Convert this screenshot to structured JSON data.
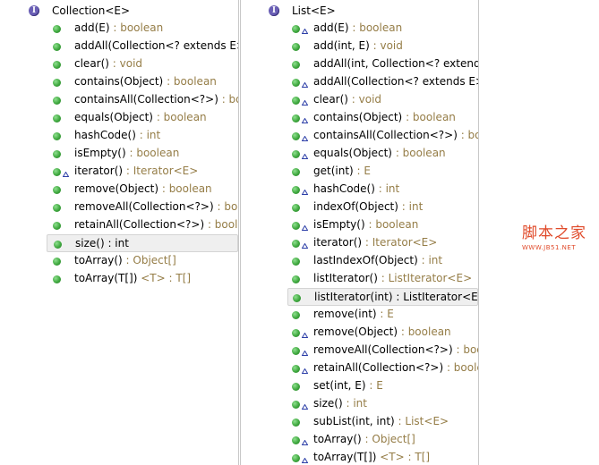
{
  "left": {
    "header": {
      "icon": "interface-icon",
      "icon_glyph": "I",
      "title": "Collection<E>"
    },
    "items": [
      {
        "sig": "add(E)",
        "ret": " : boolean",
        "abstract": false
      },
      {
        "sig": "addAll(Collection<? extends E>",
        "ret": "",
        "abstract": false
      },
      {
        "sig": "clear()",
        "ret": " : void",
        "abstract": false
      },
      {
        "sig": "contains(Object)",
        "ret": " : boolean",
        "abstract": false
      },
      {
        "sig": "containsAll(Collection<?>)",
        "ret": " : boo",
        "abstract": false
      },
      {
        "sig": "equals(Object)",
        "ret": " : boolean",
        "abstract": false
      },
      {
        "sig": "hashCode()",
        "ret": " : int",
        "abstract": false
      },
      {
        "sig": "isEmpty()",
        "ret": " : boolean",
        "abstract": false
      },
      {
        "sig": "iterator()",
        "ret": " : Iterator<E>",
        "abstract": true
      },
      {
        "sig": "remove(Object)",
        "ret": " : boolean",
        "abstract": false
      },
      {
        "sig": "removeAll(Collection<?>)",
        "ret": " : boo",
        "abstract": false
      },
      {
        "sig": "retainAll(Collection<?>)",
        "ret": " : boole",
        "abstract": false
      },
      {
        "sig": "size() : int",
        "ret": "",
        "abstract": false,
        "selected": true
      },
      {
        "sig": "toArray()",
        "ret": " : Object[]",
        "abstract": false
      },
      {
        "sig": "toArray(T[])",
        "ret": " <T> : T[]",
        "abstract": false
      }
    ]
  },
  "right": {
    "header": {
      "icon": "interface-icon",
      "icon_glyph": "I",
      "title": "List<E>"
    },
    "items": [
      {
        "sig": "add(E)",
        "ret": " : boolean",
        "abstract": true
      },
      {
        "sig": "add(int, E)",
        "ret": " : void",
        "abstract": false
      },
      {
        "sig": "addAll(int, Collection<? extends",
        "ret": "",
        "abstract": false
      },
      {
        "sig": "addAll(Collection<? extends E>",
        "ret": "",
        "abstract": true
      },
      {
        "sig": "clear()",
        "ret": " : void",
        "abstract": true
      },
      {
        "sig": "contains(Object)",
        "ret": " : boolean",
        "abstract": true
      },
      {
        "sig": "containsAll(Collection<?>)",
        "ret": " : boo",
        "abstract": true
      },
      {
        "sig": "equals(Object)",
        "ret": " : boolean",
        "abstract": true
      },
      {
        "sig": "get(int)",
        "ret": " : E",
        "abstract": false
      },
      {
        "sig": "hashCode()",
        "ret": " : int",
        "abstract": true
      },
      {
        "sig": "indexOf(Object)",
        "ret": " : int",
        "abstract": false
      },
      {
        "sig": "isEmpty()",
        "ret": " : boolean",
        "abstract": true
      },
      {
        "sig": "iterator()",
        "ret": " : Iterator<E>",
        "abstract": true
      },
      {
        "sig": "lastIndexOf(Object)",
        "ret": " : int",
        "abstract": false
      },
      {
        "sig": "listIterator()",
        "ret": " : ListIterator<E>",
        "abstract": false
      },
      {
        "sig": "listIterator(int) : ListIterator<E>",
        "ret": "",
        "abstract": false,
        "selected": true
      },
      {
        "sig": "remove(int)",
        "ret": " : E",
        "abstract": false
      },
      {
        "sig": "remove(Object)",
        "ret": " : boolean",
        "abstract": true
      },
      {
        "sig": "removeAll(Collection<?>)",
        "ret": " : boo",
        "abstract": true
      },
      {
        "sig": "retainAll(Collection<?>)",
        "ret": " : boole",
        "abstract": true
      },
      {
        "sig": "set(int, E)",
        "ret": " : E",
        "abstract": false
      },
      {
        "sig": "size()",
        "ret": " : int",
        "abstract": true
      },
      {
        "sig": "subList(int, int)",
        "ret": " : List<E>",
        "abstract": false
      },
      {
        "sig": "toArray()",
        "ret": " : Object[]",
        "abstract": true
      },
      {
        "sig": "toArray(T[])",
        "ret": " <T> : T[]",
        "abstract": true
      }
    ]
  },
  "watermark": {
    "cn": "脚本之家",
    "url": "WWW.JB51.NET"
  },
  "colors": {
    "return_type": "#957d47",
    "interface_icon": "#6a5fb5",
    "method_dot": "#3fa83f",
    "override_triangle": "#2d3fa8",
    "watermark": "#e04a2a"
  }
}
